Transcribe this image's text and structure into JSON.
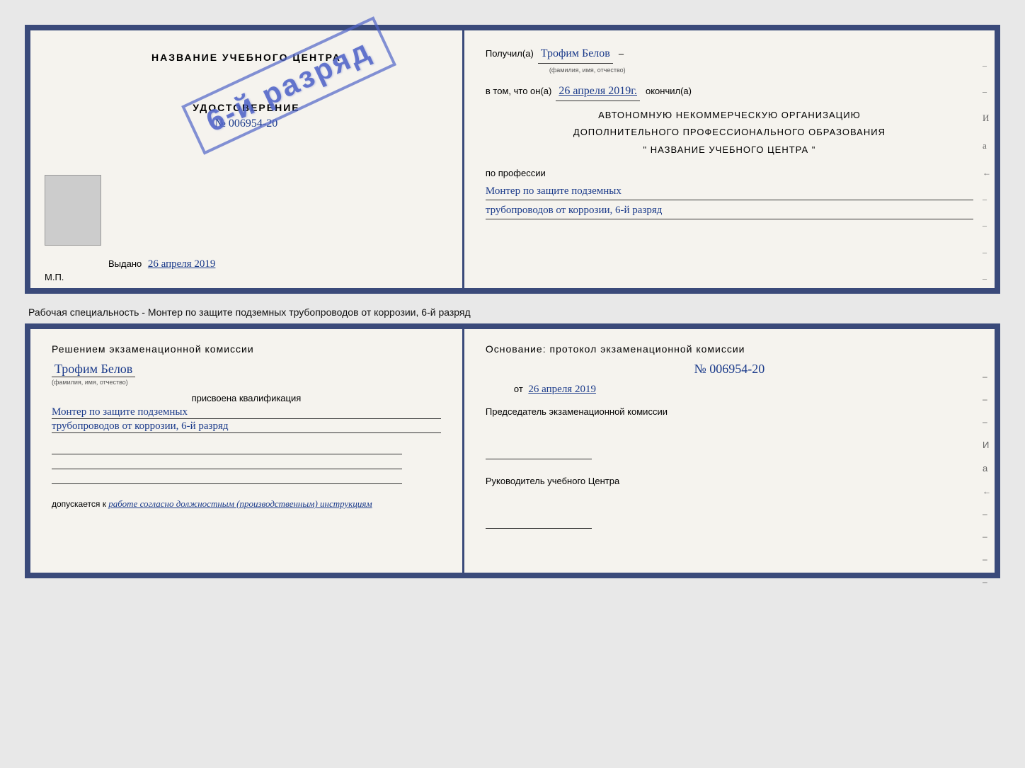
{
  "page": {
    "background_color": "#e8e8e8"
  },
  "top_cert": {
    "left": {
      "title": "НАЗВАНИЕ УЧЕБНОГО ЦЕНТРА",
      "stamp_text": "6-й разряд",
      "udost_label": "УДОСТОВЕРЕНИЕ",
      "udost_number": "№ 006954-20",
      "vydano_label": "Выдано",
      "vydano_date": "26 апреля 2019",
      "mp_label": "М.П."
    },
    "right": {
      "poluchil_label": "Получил(a)",
      "poluchil_name": "Трофим Белов",
      "fio_small": "(фамилия, имя, отчество)",
      "dash1": "–",
      "vtom_label": "в том, что он(а)",
      "vtom_date": "26 апреля 2019г.",
      "okonchil_label": "окончил(а)",
      "dash2": "–",
      "org_line1": "АВТОНОМНУЮ НЕКОММЕРЧЕСКУЮ ОРГАНИЗАЦИЮ",
      "org_line2": "ДОПОЛНИТЕЛЬНОГО ПРОФЕССИОНАЛЬНОГО ОБРАЗОВАНИЯ",
      "org_line3": "\"   НАЗВАНИЕ УЧЕБНОГО ЦЕНТРА   \"",
      "dash3": "–",
      "i_label": "И",
      "a_label": "а",
      "arrow_label": "←",
      "po_professii": "по профессии",
      "profession_line1": "Монтер по защите подземных",
      "profession_line2": "трубопроводов от коррозии, 6-й разряд",
      "dashes_right": [
        "-",
        "-",
        "-",
        "-",
        "-"
      ]
    }
  },
  "middle": {
    "text": "Рабочая специальность - Монтер по защите подземных трубопроводов от коррозии, 6-й разряд"
  },
  "bottom_cert": {
    "left": {
      "title": "Решением экзаменационной комиссии",
      "name": "Трофим Белов",
      "fio_small": "(фамилия, имя, отчество)",
      "prisvoena": "присвоена квалификация",
      "qual_line1": "Монтер по защите подземных",
      "qual_line2": "трубопроводов от коррозии, 6-й разряд",
      "dopuskaetsya_label": "допускается к",
      "dopuskaetsya_text": "работе согласно должностным (производственным) инструкциям"
    },
    "right": {
      "osnovanie_label": "Основание: протокол экзаменационной комиссии",
      "number": "№ 006954-20",
      "ot_label": "от",
      "ot_date": "26 апреля 2019",
      "dash_separator": "–",
      "predsedatel_label": "Председатель экзаменационной комиссии",
      "rukovoditel_label": "Руководитель учебного Центра",
      "dashes_right": [
        "-",
        "-",
        "-",
        "И",
        "а",
        "←",
        "-",
        "-",
        "-",
        "-"
      ]
    }
  }
}
